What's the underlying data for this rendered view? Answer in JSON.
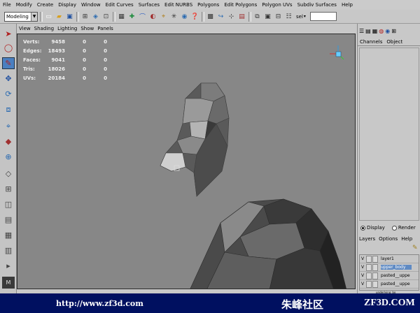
{
  "menubar": [
    "File",
    "Modify",
    "Create",
    "Display",
    "Window",
    "Edit Curves",
    "Surfaces",
    "Edit NURBS",
    "Polygons",
    "Edit Polygons",
    "Polygon UVs",
    "Subdiv Surfaces",
    "Help"
  ],
  "status": {
    "mode": "Modeling",
    "sel_label": "sel"
  },
  "viewport_menu": [
    "View",
    "Shading",
    "Lighting",
    "Show",
    "Panels"
  ],
  "stats": [
    {
      "label": "Verts:",
      "v1": "9458",
      "v2": "0",
      "v3": "0"
    },
    {
      "label": "Edges:",
      "v1": "18493",
      "v2": "0",
      "v3": "0"
    },
    {
      "label": "Faces:",
      "v1": "9041",
      "v2": "0",
      "v3": "0"
    },
    {
      "label": "Tris:",
      "v1": "18026",
      "v2": "0",
      "v3": "0"
    },
    {
      "label": "UVs:",
      "v1": "20184",
      "v2": "0",
      "v3": "0"
    }
  ],
  "right_panel": {
    "tabs": [
      "Channels",
      "Object"
    ],
    "radio": {
      "display": "Display",
      "render": "Render"
    },
    "layer_menu": [
      "Layers",
      "Options",
      "Help"
    ],
    "layers": [
      {
        "v": "V",
        "name": "layer1",
        "selected": false
      },
      {
        "v": "V",
        "name": "upper_body",
        "selected": true
      },
      {
        "v": "V",
        "name": "pasted__uppe",
        "selected": false
      },
      {
        "v": "V",
        "name": "pasted__uppe",
        "selected": false
      },
      {
        "v": "V",
        "name": "underlying_bo",
        "selected": false
      }
    ]
  },
  "footer": {
    "url": "http://www.zf3d.com",
    "brand": "朱峰社区",
    "brand_en": "ZF3D.COM"
  },
  "colors": {
    "viewport": "#878787",
    "footer": "#001060",
    "selected": "#5f8ac3"
  }
}
